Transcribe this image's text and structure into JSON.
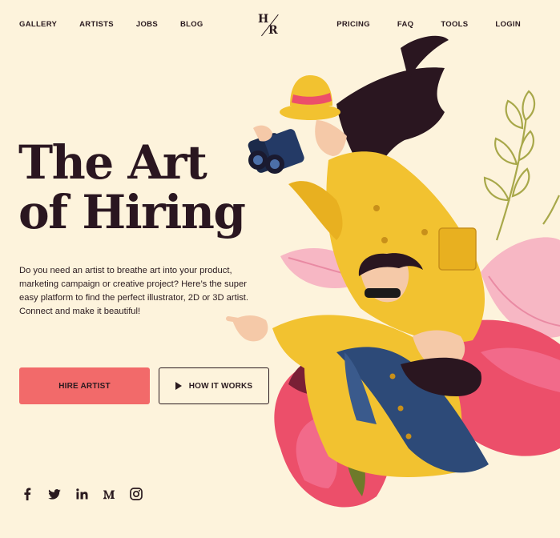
{
  "nav": {
    "left": [
      "GALLERY",
      "ARTISTS",
      "JOBS",
      "BLOG"
    ],
    "right": [
      "PRICING",
      "FAQ",
      "TOOLS",
      "LOGIN"
    ]
  },
  "logo": {
    "h": "H",
    "r": "R"
  },
  "hero": {
    "title_line1": "The Art",
    "title_line2": "of Hiring",
    "description": "Do you need an artist to breathe art into your product, marketing campaign or creative project? Here’s the super easy platform to find the perfect illustrator, 2D or 3D artist. Connect and make it beautiful!"
  },
  "buttons": {
    "hire": "HIRE ARTIST",
    "how": "HOW IT WORKS"
  },
  "social": [
    "facebook-icon",
    "twitter-icon",
    "linkedin-icon",
    "medium-icon",
    "instagram-icon"
  ],
  "colors": {
    "background": "#fdf3dc",
    "accent": "#f26a6a",
    "text": "#2a1a1f",
    "yellow": "#f2c230"
  }
}
